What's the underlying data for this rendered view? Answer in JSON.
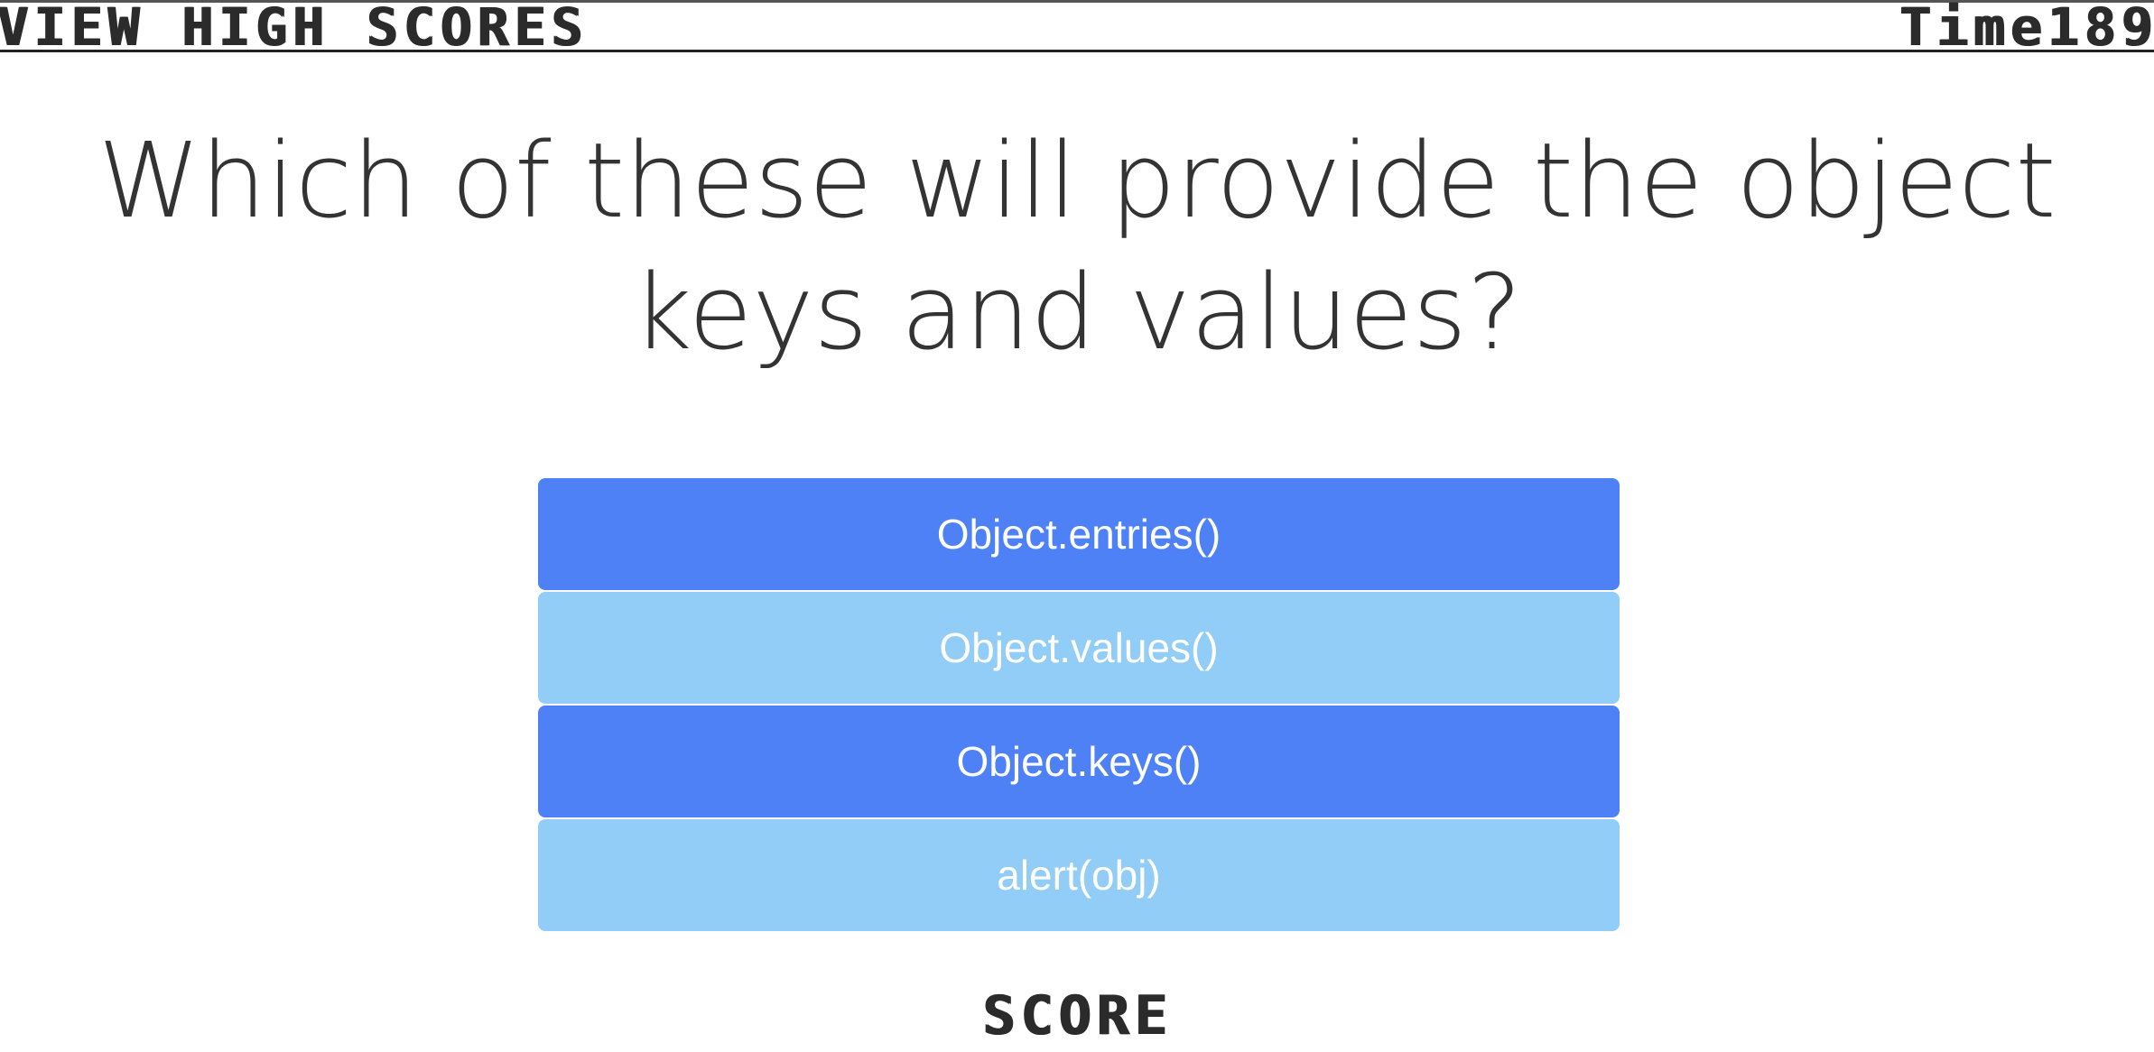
{
  "header": {
    "high_scores_label": "VIEW HIGH SCORES",
    "time_label": "Time",
    "time_value": "189"
  },
  "question": {
    "text": "Which of these will provide the object keys and values?"
  },
  "answers": [
    {
      "label": "Object.entries()",
      "color": "#4f81f6"
    },
    {
      "label": "Object.values()",
      "color": "#92cdf8"
    },
    {
      "label": "Object.keys()",
      "color": "#4f81f6"
    },
    {
      "label": "alert(obj)",
      "color": "#92cdf8"
    }
  ],
  "footer": {
    "score_label": "SCORE"
  }
}
